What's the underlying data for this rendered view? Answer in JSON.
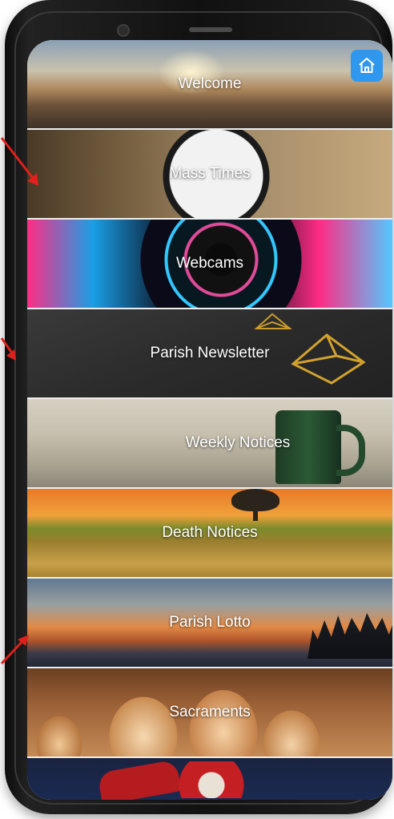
{
  "menu": {
    "items": [
      {
        "label": "Welcome"
      },
      {
        "label": "Mass Times"
      },
      {
        "label": "Webcams"
      },
      {
        "label": "Parish Newsletter"
      },
      {
        "label": "Weekly Notices"
      },
      {
        "label": "Death Notices"
      },
      {
        "label": "Parish Lotto"
      },
      {
        "label": "Sacraments"
      },
      {
        "label": ""
      }
    ]
  },
  "header": {
    "home_icon": "home-icon",
    "home_color": "#2f98ee"
  },
  "annotation": {
    "arrow_color": "#e0201a"
  }
}
